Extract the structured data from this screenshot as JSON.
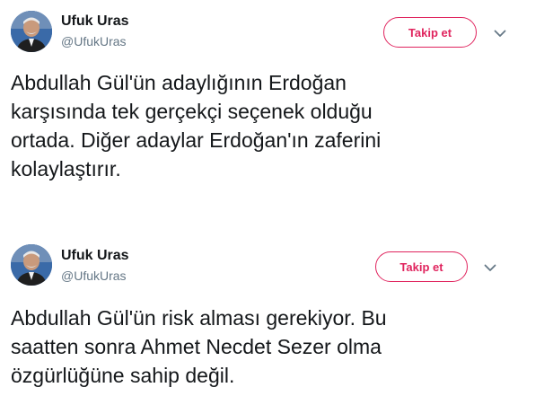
{
  "tweets": [
    {
      "author": {
        "name": "Ufuk Uras",
        "handle": "@UfukUras"
      },
      "follow_label": "Takip et",
      "lines": [
        "Abdullah Gül'ün adaylığının Erdoğan",
        "karşısında tek gerçekçi seçenek olduğu",
        "ortada. Diğer adaylar Erdoğan'ın zaferini",
        "kolaylaştırır."
      ]
    },
    {
      "author": {
        "name": "Ufuk Uras",
        "handle": "@UfukUras"
      },
      "follow_label": "Takip et",
      "lines": [
        "Abdullah Gül'ün risk alması gerekiyor. Bu",
        "saatten sonra Ahmet Necdet Sezer olma",
        "özgürlüğüne sahip değil."
      ]
    }
  ],
  "colors": {
    "follow_accent": "#e0245e",
    "handle_gray": "#657786",
    "text": "#14171a"
  },
  "icons": {
    "caret": "chevron-down-icon",
    "avatar": "avatar"
  }
}
